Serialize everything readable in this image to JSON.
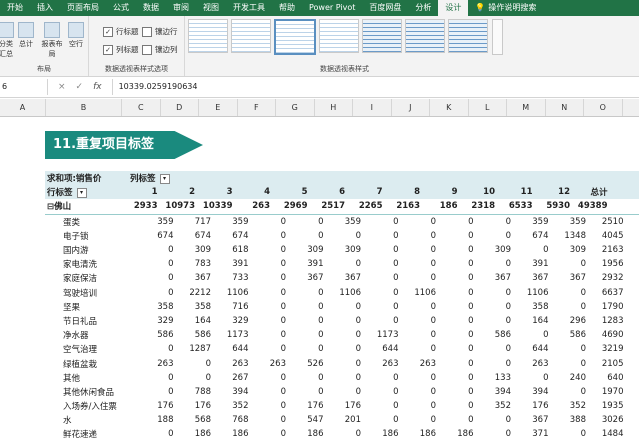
{
  "menu": {
    "tabs": [
      "开始",
      "插入",
      "页面布局",
      "公式",
      "数据",
      "审阅",
      "视图",
      "开发工具",
      "帮助",
      "Power Pivot",
      "百度网盘",
      "分析",
      "设计"
    ],
    "active_tab": "设计",
    "tell_me": "操作说明搜索"
  },
  "ribbon": {
    "group_layout": {
      "label": "布局",
      "btn_subtotal": "分类汇总",
      "btn_total": "总计",
      "btn_report": "报表布局",
      "btn_blank": "空行"
    },
    "group_options": {
      "label": "数据透视表样式选项",
      "row_headers": "行标题",
      "banded_rows": "镶边行",
      "col_headers": "列标题",
      "banded_cols": "镶边列"
    },
    "group_styles": {
      "label": "数据透视表样式"
    }
  },
  "formula_bar": {
    "name_box": "6",
    "cancel": "×",
    "enter": "✓",
    "fx": "fx",
    "value": "10339.0259190634"
  },
  "columns": [
    "B",
    "C",
    "D",
    "E",
    "F",
    "G",
    "H",
    "I",
    "J",
    "K",
    "L",
    "M",
    "N",
    "O"
  ],
  "col_a": "A",
  "banner": {
    "title": "11.重复项目标签"
  },
  "pivot": {
    "measure_label": "求和项:销售价",
    "col_labels_label": "列标签",
    "row_labels_label": "行标签",
    "col_headers": [
      "1",
      "2",
      "3",
      "4",
      "5",
      "6",
      "7",
      "8",
      "9",
      "10",
      "11",
      "12",
      "总计"
    ],
    "group": {
      "name": "佛山",
      "expander": "⊟",
      "values": [
        "2933",
        "10973",
        "10339",
        "263",
        "2969",
        "2517",
        "2265",
        "2163",
        "186",
        "2318",
        "6533",
        "5930",
        "49389"
      ]
    },
    "rows": [
      {
        "name": "蛋类",
        "values": [
          "359",
          "717",
          "359",
          "0",
          "0",
          "359",
          "0",
          "0",
          "0",
          "0",
          "359",
          "359",
          "2510"
        ]
      },
      {
        "name": "电子锁",
        "values": [
          "674",
          "674",
          "674",
          "0",
          "0",
          "0",
          "0",
          "0",
          "0",
          "0",
          "674",
          "1348",
          "4045"
        ]
      },
      {
        "name": "国内游",
        "values": [
          "0",
          "309",
          "618",
          "0",
          "309",
          "309",
          "0",
          "0",
          "0",
          "309",
          "0",
          "309",
          "2163"
        ]
      },
      {
        "name": "家电清洗",
        "values": [
          "0",
          "783",
          "391",
          "0",
          "391",
          "0",
          "0",
          "0",
          "0",
          "0",
          "391",
          "0",
          "1956"
        ]
      },
      {
        "name": "家庭保洁",
        "values": [
          "0",
          "367",
          "733",
          "0",
          "367",
          "367",
          "0",
          "0",
          "0",
          "367",
          "367",
          "367",
          "2932"
        ]
      },
      {
        "name": "驾驶培训",
        "values": [
          "0",
          "2212",
          "1106",
          "0",
          "0",
          "1106",
          "0",
          "1106",
          "0",
          "0",
          "1106",
          "0",
          "6637"
        ]
      },
      {
        "name": "坚果",
        "values": [
          "358",
          "358",
          "716",
          "0",
          "0",
          "0",
          "0",
          "0",
          "0",
          "0",
          "358",
          "0",
          "1790"
        ]
      },
      {
        "name": "节日礼品",
        "values": [
          "329",
          "164",
          "329",
          "0",
          "0",
          "0",
          "0",
          "0",
          "0",
          "0",
          "164",
          "296",
          "1283"
        ]
      },
      {
        "name": "净水器",
        "values": [
          "586",
          "586",
          "1173",
          "0",
          "0",
          "0",
          "1173",
          "0",
          "0",
          "586",
          "0",
          "586",
          "4690"
        ]
      },
      {
        "name": "空气治理",
        "values": [
          "0",
          "1287",
          "644",
          "0",
          "0",
          "0",
          "644",
          "0",
          "0",
          "0",
          "644",
          "0",
          "3219"
        ]
      },
      {
        "name": "绿植盆栽",
        "values": [
          "263",
          "0",
          "263",
          "263",
          "526",
          "0",
          "263",
          "263",
          "0",
          "0",
          "263",
          "0",
          "2105"
        ]
      },
      {
        "name": "其他",
        "values": [
          "0",
          "0",
          "267",
          "0",
          "0",
          "0",
          "0",
          "0",
          "0",
          "133",
          "0",
          "240",
          "640"
        ]
      },
      {
        "name": "其他休闲食品",
        "values": [
          "0",
          "788",
          "394",
          "0",
          "0",
          "0",
          "0",
          "0",
          "0",
          "394",
          "394",
          "0",
          "1970"
        ]
      },
      {
        "name": "入场券/入住票",
        "values": [
          "176",
          "176",
          "352",
          "0",
          "176",
          "176",
          "0",
          "0",
          "0",
          "352",
          "176",
          "352",
          "1935"
        ]
      },
      {
        "name": "水",
        "values": [
          "188",
          "568",
          "768",
          "0",
          "547",
          "201",
          "0",
          "0",
          "0",
          "0",
          "367",
          "388",
          "3026"
        ]
      },
      {
        "name": "鲜花速递",
        "values": [
          "0",
          "186",
          "186",
          "0",
          "186",
          "0",
          "186",
          "186",
          "186",
          "0",
          "371",
          "0",
          "1484"
        ]
      }
    ]
  }
}
